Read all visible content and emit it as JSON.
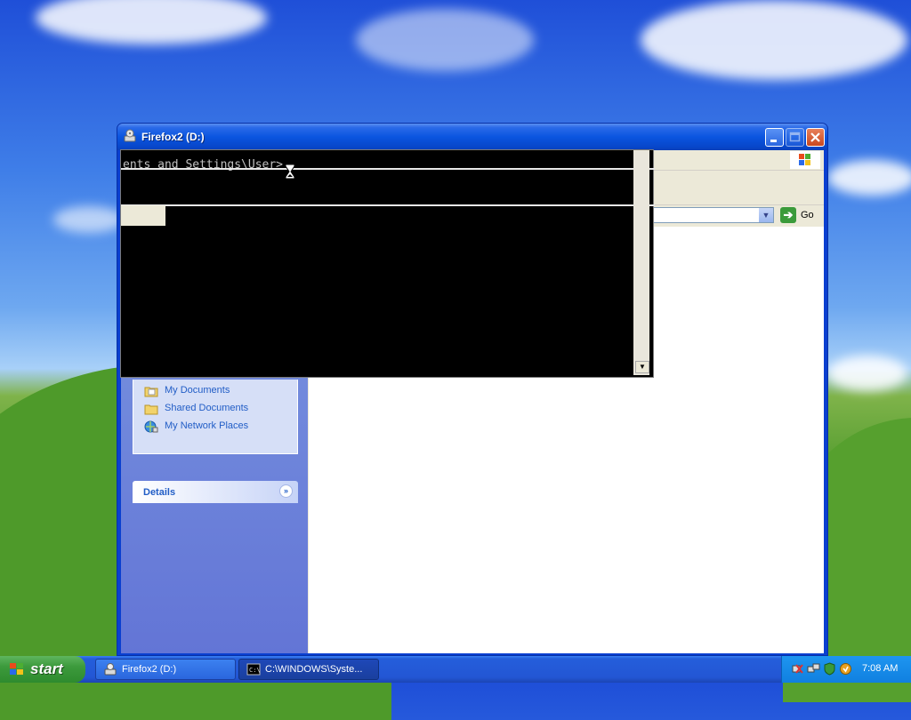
{
  "window": {
    "title": "Firefox2 (D:)"
  },
  "console": {
    "prompt_text": "ents and Settings\\User>"
  },
  "address": {
    "go_label": "Go"
  },
  "places": {
    "items": [
      {
        "label": "My Documents",
        "icon": "folder-documents-icon"
      },
      {
        "label": "Shared Documents",
        "icon": "folder-icon"
      },
      {
        "label": "My Network Places",
        "icon": "network-places-icon"
      }
    ]
  },
  "details": {
    "title": "Details"
  },
  "taskbar": {
    "start_label": "start",
    "tasks": [
      {
        "label": "Firefox2 (D:)",
        "icon": "drive-icon"
      },
      {
        "label": "C:\\WINDOWS\\Syste...",
        "icon": "cmd-icon"
      }
    ],
    "clock": "7:08 AM"
  },
  "colors": {
    "titlebar": "#0a55e0",
    "taskbar": "#245edb",
    "start_button": "#3c9a3c",
    "taskpane": "#6375d6",
    "link_text": "#215dc6"
  }
}
